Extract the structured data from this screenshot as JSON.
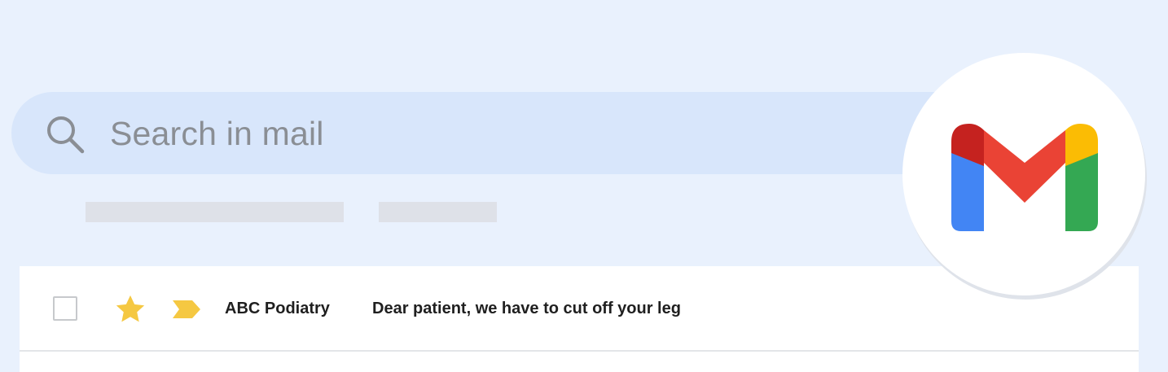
{
  "search": {
    "placeholder": "Search in mail",
    "icon": "search-icon"
  },
  "email_list": {
    "rows": [
      {
        "sender": "ABC Podiatry",
        "subject": "Dear patient, we have to cut off your leg",
        "starred": true,
        "important": true,
        "selected": false
      }
    ]
  },
  "logo": {
    "name": "gmail-logo"
  },
  "colors": {
    "background": "#e9f1fd",
    "search_bar": "#d8e6fb",
    "star": "#f5c842",
    "gmail_red": "#ea4335",
    "gmail_dark_red": "#c5221f",
    "gmail_blue": "#4285f4",
    "gmail_green": "#34a853",
    "gmail_yellow": "#fbbc04"
  }
}
